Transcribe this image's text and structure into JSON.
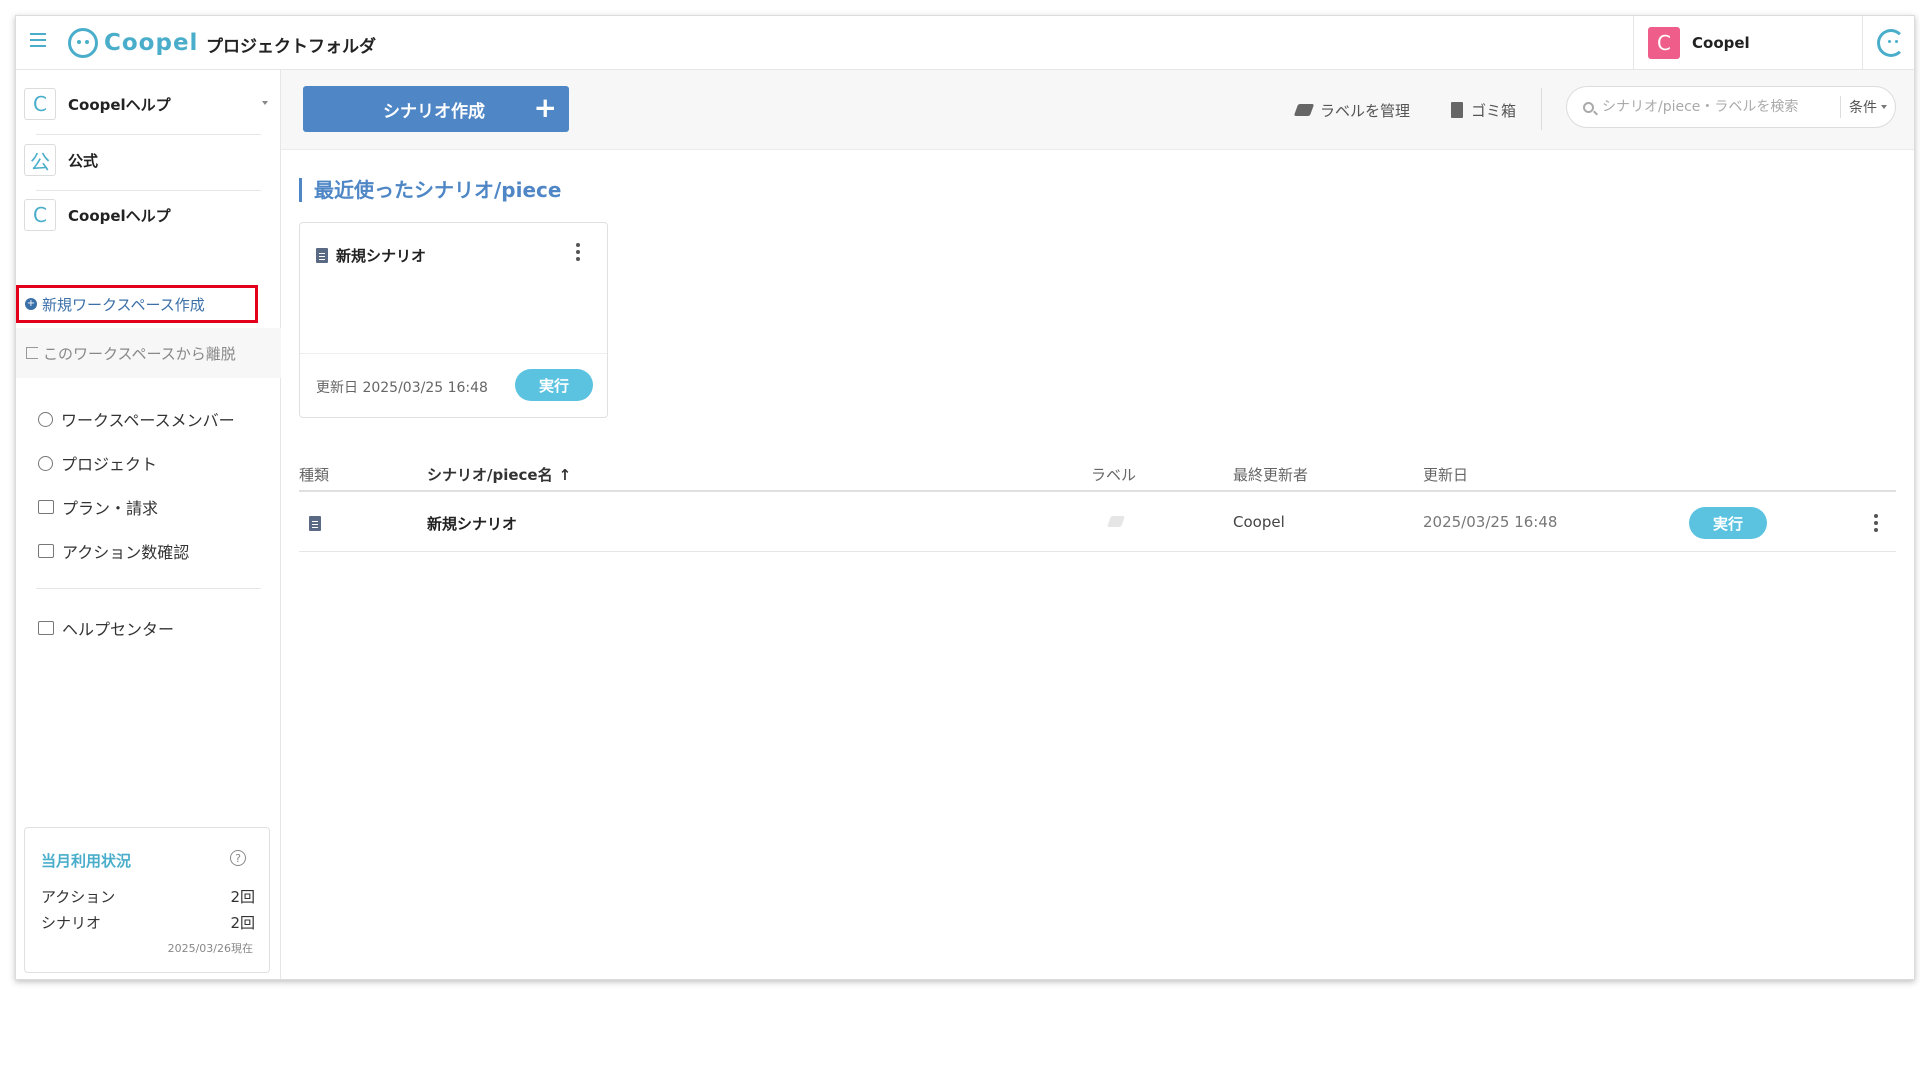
{
  "header": {
    "logo_text": "Coopel",
    "page_title": "プロジェクトフォルダ",
    "user_initial": "C",
    "user_name": "Coopel"
  },
  "sidebar": {
    "current_workspace": {
      "initial": "C",
      "label": "Coopelヘルプ"
    },
    "workspaces": [
      {
        "initial": "公",
        "label": "公式"
      },
      {
        "initial": "C",
        "label": "Coopelヘルプ"
      }
    ],
    "new_workspace_label": "新規ワークスペース作成",
    "leave_workspace_label": "このワークスペースから離脱",
    "menu": [
      {
        "label": "ワークスペースメンバー",
        "icon": "members-icon"
      },
      {
        "label": "プロジェクト",
        "icon": "project-icon"
      },
      {
        "label": "プラン・請求",
        "icon": "card-icon"
      },
      {
        "label": "アクション数確認",
        "icon": "calendar-icon"
      }
    ],
    "help_center_label": "ヘルプセンター",
    "usage": {
      "title": "当月利用状況",
      "help_glyph": "?",
      "rows": [
        {
          "label": "アクション",
          "value": "2回"
        },
        {
          "label": "シナリオ",
          "value": "2回"
        }
      ],
      "as_of": "2025/03/26現在"
    }
  },
  "toolbar": {
    "create_label": "シナリオ作成",
    "create_plus": "+",
    "manage_labels": "ラベルを管理",
    "trash": "ゴミ箱",
    "search_placeholder": "シナリオ/piece・ラベルを検索",
    "conditions_label": "条件"
  },
  "recent": {
    "title": "最近使ったシナリオ/piece",
    "cards": [
      {
        "title": "新規シナリオ",
        "updated": "更新日 2025/03/25 16:48",
        "run_label": "実行"
      }
    ]
  },
  "table": {
    "headers": {
      "type": "種類",
      "name": "シナリオ/piece名",
      "sort_arrow": "↑",
      "label": "ラベル",
      "updated_by": "最終更新者",
      "updated": "更新日"
    },
    "rows": [
      {
        "name": "新規シナリオ",
        "updated_by": "Coopel",
        "updated": "2025/03/25 16:48",
        "run_label": "実行"
      }
    ]
  },
  "colors": {
    "brand": "#4aaecb",
    "primary_button": "#4f87c6",
    "run_button": "#5bc3e0",
    "highlight_border": "#e3001b",
    "avatar": "#ef5d8a"
  }
}
